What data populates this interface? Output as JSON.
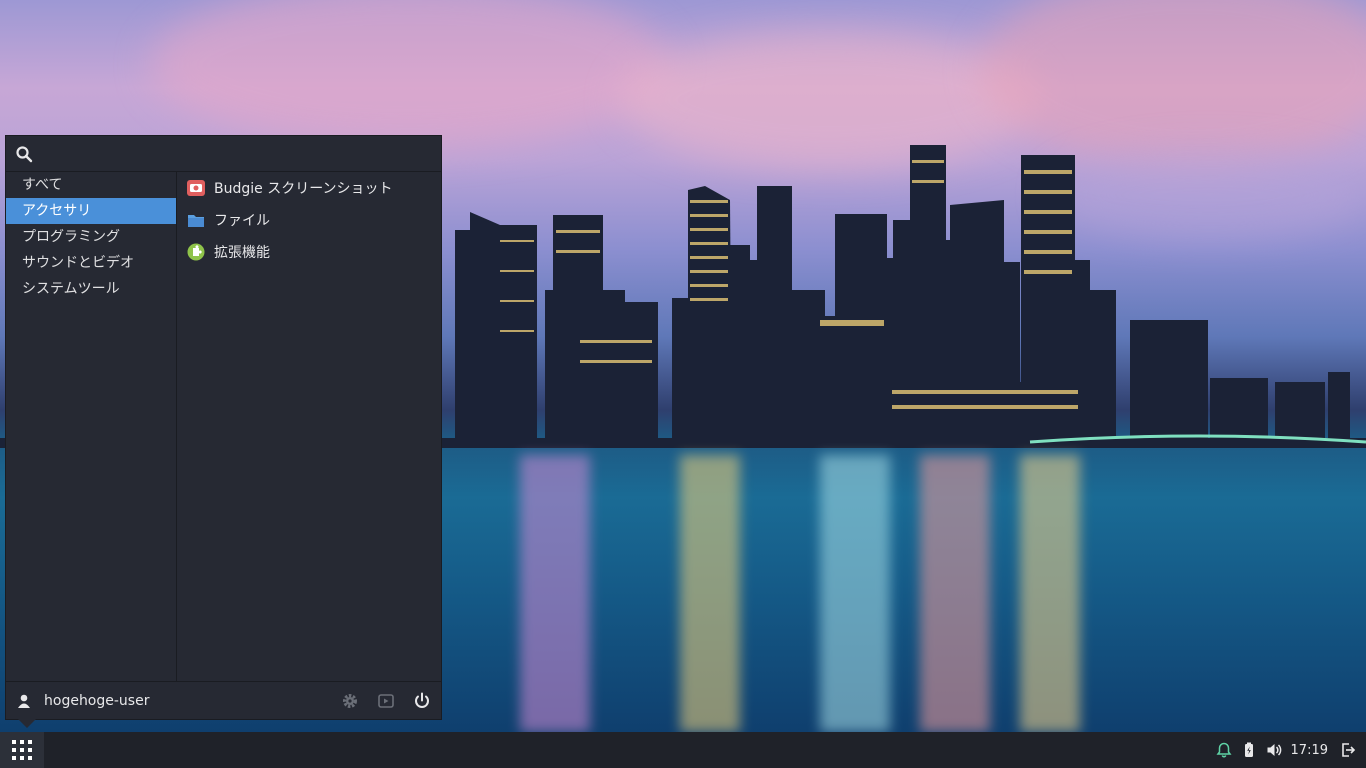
{
  "search": {
    "placeholder": "",
    "value": ""
  },
  "categories": [
    {
      "label": "すべて"
    },
    {
      "label": "アクセサリ",
      "active": true
    },
    {
      "label": "プログラミング"
    },
    {
      "label": "サウンドとビデオ"
    },
    {
      "label": "システムツール"
    }
  ],
  "apps": [
    {
      "label": "Budgie スクリーンショット",
      "icon": "screenshot-icon"
    },
    {
      "label": "ファイル",
      "icon": "folder-icon"
    },
    {
      "label": "拡張機能",
      "icon": "puzzle-icon"
    }
  ],
  "footer": {
    "username": "hogehoge-user",
    "icons": [
      "user-icon",
      "settings-icon",
      "media-icon",
      "power-icon"
    ]
  },
  "panel": {
    "clock": "17:19",
    "icons": [
      "app-grid-icon",
      "notification-bell-icon",
      "battery-icon",
      "volume-icon",
      "logout-icon"
    ]
  },
  "colors": {
    "accent": "#4a90d9",
    "menu_bg": "#262933",
    "panel_bg": "#1f2229",
    "notification": "#5fd3a6"
  }
}
